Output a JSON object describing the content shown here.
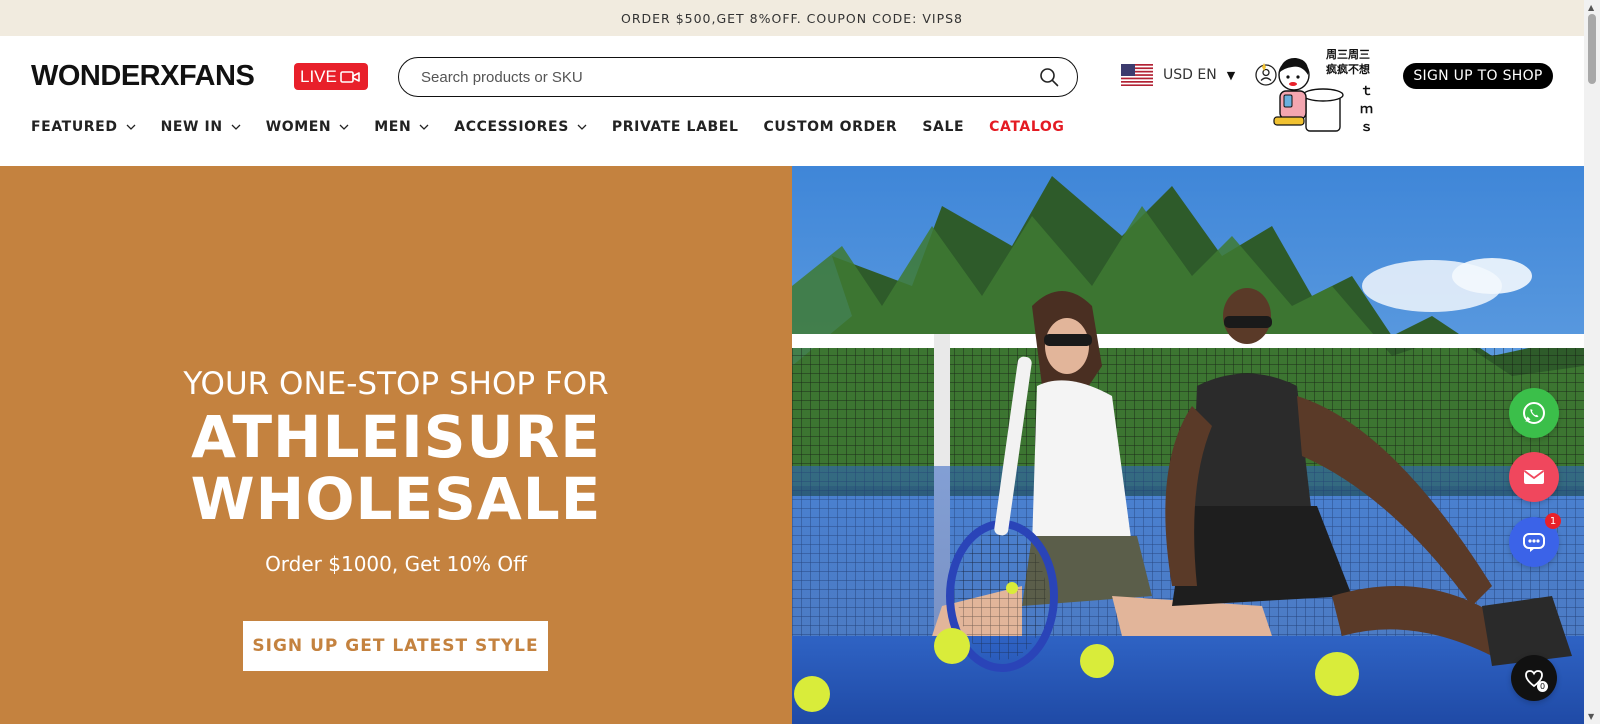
{
  "announcement": "ORDER $500,GET 8%OFF. COUPON CODE: VIPS8",
  "header": {
    "logo": "WONDERXFANS",
    "live_label": "LIVE",
    "search_placeholder": "Search products or SKU",
    "currency_label": "USD EN",
    "account_label": "IN",
    "sticker_lines": [
      "周三周三",
      "疯疯不想",
      "ｔ",
      "ｍ",
      "ｓ"
    ],
    "signup_label": "SIGN UP TO SHOP"
  },
  "nav": [
    {
      "label": "FEATURED",
      "dropdown": true
    },
    {
      "label": "NEW IN",
      "dropdown": true
    },
    {
      "label": "WOMEN",
      "dropdown": true
    },
    {
      "label": "MEN",
      "dropdown": true
    },
    {
      "label": "ACCESSIORES",
      "dropdown": true
    },
    {
      "label": "PRIVATE LABEL",
      "dropdown": false
    },
    {
      "label": "CUSTOM ORDER",
      "dropdown": false
    },
    {
      "label": "SALE",
      "dropdown": false
    },
    {
      "label": "CATALOG",
      "dropdown": false,
      "color": "#e41b23"
    }
  ],
  "hero": {
    "kicker": "YOUR ONE-STOP SHOP FOR",
    "title_line1": "ATHLEISURE",
    "title_line2": "WHOLESALE",
    "subtitle": "Order $1000, Get 10% Off",
    "cta": "SIGN UP GET LATEST STYLE",
    "bg_color": "#c4823f"
  },
  "floating": {
    "whatsapp_icon": "whatsapp-icon",
    "email_icon": "email-icon",
    "chat_icon": "chat-icon",
    "chat_badge": "1",
    "wishlist_icon": "heart-icon",
    "wishlist_count": "0"
  }
}
